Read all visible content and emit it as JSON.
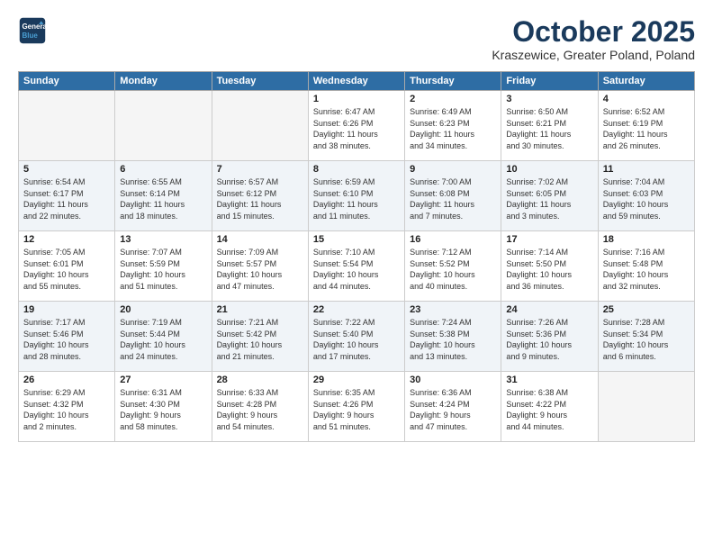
{
  "header": {
    "logo_line1": "General",
    "logo_line2": "Blue",
    "month_title": "October 2025",
    "location": "Kraszewice, Greater Poland, Poland"
  },
  "days_of_week": [
    "Sunday",
    "Monday",
    "Tuesday",
    "Wednesday",
    "Thursday",
    "Friday",
    "Saturday"
  ],
  "weeks": [
    [
      {
        "day": "",
        "info": ""
      },
      {
        "day": "",
        "info": ""
      },
      {
        "day": "",
        "info": ""
      },
      {
        "day": "1",
        "info": "Sunrise: 6:47 AM\nSunset: 6:26 PM\nDaylight: 11 hours\nand 38 minutes."
      },
      {
        "day": "2",
        "info": "Sunrise: 6:49 AM\nSunset: 6:23 PM\nDaylight: 11 hours\nand 34 minutes."
      },
      {
        "day": "3",
        "info": "Sunrise: 6:50 AM\nSunset: 6:21 PM\nDaylight: 11 hours\nand 30 minutes."
      },
      {
        "day": "4",
        "info": "Sunrise: 6:52 AM\nSunset: 6:19 PM\nDaylight: 11 hours\nand 26 minutes."
      }
    ],
    [
      {
        "day": "5",
        "info": "Sunrise: 6:54 AM\nSunset: 6:17 PM\nDaylight: 11 hours\nand 22 minutes."
      },
      {
        "day": "6",
        "info": "Sunrise: 6:55 AM\nSunset: 6:14 PM\nDaylight: 11 hours\nand 18 minutes."
      },
      {
        "day": "7",
        "info": "Sunrise: 6:57 AM\nSunset: 6:12 PM\nDaylight: 11 hours\nand 15 minutes."
      },
      {
        "day": "8",
        "info": "Sunrise: 6:59 AM\nSunset: 6:10 PM\nDaylight: 11 hours\nand 11 minutes."
      },
      {
        "day": "9",
        "info": "Sunrise: 7:00 AM\nSunset: 6:08 PM\nDaylight: 11 hours\nand 7 minutes."
      },
      {
        "day": "10",
        "info": "Sunrise: 7:02 AM\nSunset: 6:05 PM\nDaylight: 11 hours\nand 3 minutes."
      },
      {
        "day": "11",
        "info": "Sunrise: 7:04 AM\nSunset: 6:03 PM\nDaylight: 10 hours\nand 59 minutes."
      }
    ],
    [
      {
        "day": "12",
        "info": "Sunrise: 7:05 AM\nSunset: 6:01 PM\nDaylight: 10 hours\nand 55 minutes."
      },
      {
        "day": "13",
        "info": "Sunrise: 7:07 AM\nSunset: 5:59 PM\nDaylight: 10 hours\nand 51 minutes."
      },
      {
        "day": "14",
        "info": "Sunrise: 7:09 AM\nSunset: 5:57 PM\nDaylight: 10 hours\nand 47 minutes."
      },
      {
        "day": "15",
        "info": "Sunrise: 7:10 AM\nSunset: 5:54 PM\nDaylight: 10 hours\nand 44 minutes."
      },
      {
        "day": "16",
        "info": "Sunrise: 7:12 AM\nSunset: 5:52 PM\nDaylight: 10 hours\nand 40 minutes."
      },
      {
        "day": "17",
        "info": "Sunrise: 7:14 AM\nSunset: 5:50 PM\nDaylight: 10 hours\nand 36 minutes."
      },
      {
        "day": "18",
        "info": "Sunrise: 7:16 AM\nSunset: 5:48 PM\nDaylight: 10 hours\nand 32 minutes."
      }
    ],
    [
      {
        "day": "19",
        "info": "Sunrise: 7:17 AM\nSunset: 5:46 PM\nDaylight: 10 hours\nand 28 minutes."
      },
      {
        "day": "20",
        "info": "Sunrise: 7:19 AM\nSunset: 5:44 PM\nDaylight: 10 hours\nand 24 minutes."
      },
      {
        "day": "21",
        "info": "Sunrise: 7:21 AM\nSunset: 5:42 PM\nDaylight: 10 hours\nand 21 minutes."
      },
      {
        "day": "22",
        "info": "Sunrise: 7:22 AM\nSunset: 5:40 PM\nDaylight: 10 hours\nand 17 minutes."
      },
      {
        "day": "23",
        "info": "Sunrise: 7:24 AM\nSunset: 5:38 PM\nDaylight: 10 hours\nand 13 minutes."
      },
      {
        "day": "24",
        "info": "Sunrise: 7:26 AM\nSunset: 5:36 PM\nDaylight: 10 hours\nand 9 minutes."
      },
      {
        "day": "25",
        "info": "Sunrise: 7:28 AM\nSunset: 5:34 PM\nDaylight: 10 hours\nand 6 minutes."
      }
    ],
    [
      {
        "day": "26",
        "info": "Sunrise: 6:29 AM\nSunset: 4:32 PM\nDaylight: 10 hours\nand 2 minutes."
      },
      {
        "day": "27",
        "info": "Sunrise: 6:31 AM\nSunset: 4:30 PM\nDaylight: 9 hours\nand 58 minutes."
      },
      {
        "day": "28",
        "info": "Sunrise: 6:33 AM\nSunset: 4:28 PM\nDaylight: 9 hours\nand 54 minutes."
      },
      {
        "day": "29",
        "info": "Sunrise: 6:35 AM\nSunset: 4:26 PM\nDaylight: 9 hours\nand 51 minutes."
      },
      {
        "day": "30",
        "info": "Sunrise: 6:36 AM\nSunset: 4:24 PM\nDaylight: 9 hours\nand 47 minutes."
      },
      {
        "day": "31",
        "info": "Sunrise: 6:38 AM\nSunset: 4:22 PM\nDaylight: 9 hours\nand 44 minutes."
      },
      {
        "day": "",
        "info": ""
      }
    ]
  ]
}
